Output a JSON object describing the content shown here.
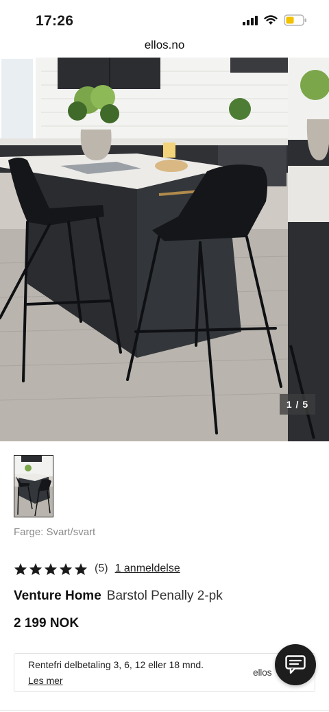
{
  "status_bar": {
    "time": "17:26",
    "battery_color": "#f2c200"
  },
  "browser": {
    "url": "ellos.no"
  },
  "gallery": {
    "counter": "1 / 5",
    "current": 1,
    "total": 5
  },
  "product": {
    "color_label": "Farge: Svart/svart",
    "rating": 5,
    "rating_count": "(5)",
    "review_link": "1 anmeldelse",
    "brand": "Venture Home",
    "name": "Barstol Penally 2-pk",
    "price": "2 199 NOK"
  },
  "finance": {
    "text": "Rentefri delbetaling 3, 6, 12 eller 18 mnd.",
    "link": "Les mer",
    "brand": "ellos"
  },
  "icons": {
    "signal": "signal-icon",
    "wifi": "wifi-icon",
    "battery": "battery-icon",
    "star": "star-icon",
    "chat": "chat-icon"
  },
  "colors": {
    "star": "#1a1a1a",
    "chat_button": "#1d1d1d"
  }
}
